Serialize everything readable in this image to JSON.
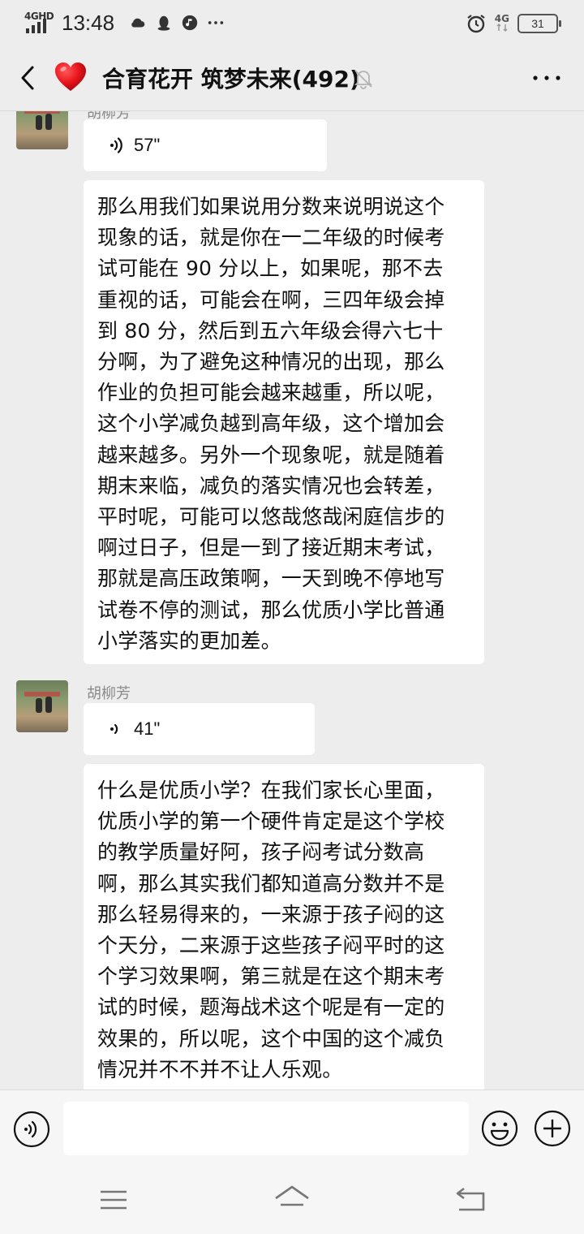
{
  "status_bar": {
    "network_label": "4GHD",
    "time": "13:48",
    "network_right": "4G",
    "battery_level": "31"
  },
  "header": {
    "title": "合育花开 筑梦未来(492)"
  },
  "messages": [
    {
      "sender": "胡柳芳",
      "voice_duration": "57\"",
      "text_lines": [
        "那么用我们如果说用分数来说明说这个",
        "现象的话，就是你在一二年级的时候考",
        "试可能在 90 分以上，如果呢，那不去",
        "重视的话，可能会在啊，三四年级会掉",
        "到 80 分，然后到五六年级会得六七十",
        "分啊，为了避免这种情况的出现，那么",
        "作业的负担可能会越来越重，所以呢，",
        "这个小学减负越到高年级，这个增加会",
        "越来越多。另外一个现象呢，就是随着",
        "期末来临，减负的落实情况也会转差，",
        "平时呢，可能可以悠哉悠哉闲庭信步的",
        "啊过日子，但是一到了接近期末考试，",
        "那就是高压政策啊，一天到晚不停地写",
        "试卷不停的测试，那么优质小学比普通",
        "小学落实的更加差。"
      ]
    },
    {
      "sender": "胡柳芳",
      "voice_duration": "41\"",
      "text_lines": [
        "什么是优质小学？在我们家长心里面，",
        "优质小学的第一个硬件肯定是这个学校",
        "的教学质量好阿，孩子闷考试分数高",
        "啊，那么其实我们都知道高分数并不是",
        "那么轻易得来的，一来源于孩子闷的这",
        "个天分，二来源于这些孩子闷平时的这",
        "个学习效果啊，第三就是在这个期末考",
        "试的时候，题海战术这个呢是有一定的",
        "效果的，所以呢，这个中国的这个减负",
        "情况并不不并不让人乐观。"
      ]
    }
  ],
  "input": {
    "value": "",
    "placeholder": ""
  },
  "icons": {
    "back": "chevron-left-icon",
    "group": "heart-icon",
    "mute": "bell-off-icon",
    "more": "more-dots-icon",
    "voice": "voice-wave-icon",
    "emoji": "smiley-icon",
    "plus": "plus-circle-icon"
  },
  "colors": {
    "background": "#ededed",
    "bubble": "#ffffff",
    "heart": "#e8141c",
    "sender_name": "#8a8a8a"
  }
}
